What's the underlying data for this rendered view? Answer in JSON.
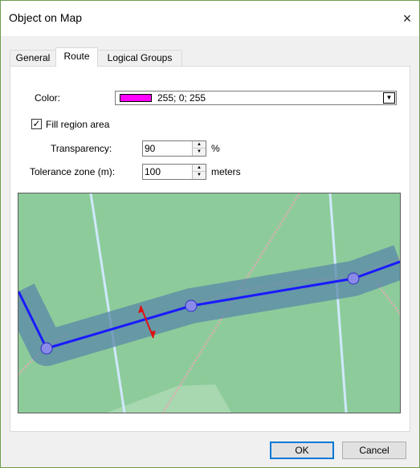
{
  "window": {
    "title": "Object on Map",
    "close_icon": "×"
  },
  "tabs": [
    {
      "label": "General",
      "active": false
    },
    {
      "label": "Route",
      "active": true
    },
    {
      "label": "Logical Groups",
      "active": false
    }
  ],
  "route": {
    "color_label": "Color:",
    "color_value": "255; 0; 255",
    "color_hex": "#ff00ff",
    "fill_label": "Fill region area",
    "fill_checked": true,
    "check_glyph": "✓",
    "transparency_label": "Transparency:",
    "transparency_value": "90",
    "transparency_unit": "%",
    "tolerance_label": "Tolerance zone (m):",
    "tolerance_value": "100",
    "tolerance_unit": "meters",
    "dropdown_glyph": "▼",
    "spin_up_glyph": "▲",
    "spin_down_glyph": "▼"
  },
  "map_colors": {
    "land": "#8dcc9a",
    "route_line": "#1a1aff",
    "tolerance_zone": "#5a88a8",
    "vertex": "#8a8ae8",
    "arrow": "#e01010",
    "road": "#d0e8ff",
    "dotted_path": "#d8b0b0"
  },
  "footer": {
    "ok_label": "OK",
    "cancel_label": "Cancel"
  }
}
